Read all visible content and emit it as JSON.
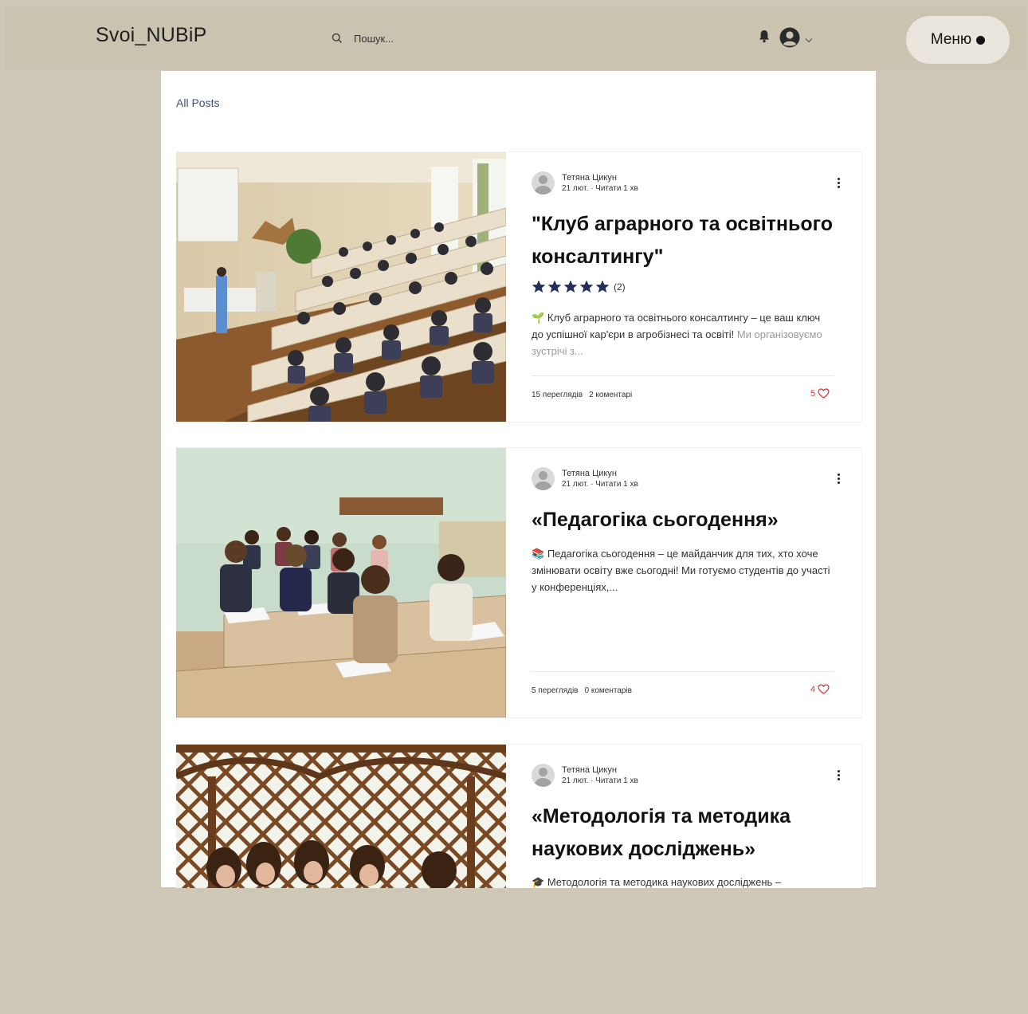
{
  "header": {
    "logo": "Svoi_NUBiP",
    "search_placeholder": "Пошук...",
    "menu_label": "Меню"
  },
  "breadcrumb": "All Posts",
  "colors": {
    "background": "#cfc8b6",
    "header": "#cac3b0",
    "panel": "#ffffff",
    "star": "#23305c",
    "heart": "#d23a3a",
    "link": "#3e5170"
  },
  "posts": [
    {
      "author": "Тетяна Цикун",
      "date": "21 лют.",
      "read_time": "Читати 1 хв",
      "title": "\"Клуб аграрного та освітнього консалтингу\"",
      "rating_count": "(2)",
      "rating": 5,
      "excerpt_icon": "🌱",
      "excerpt": "Клуб аграрного та освітнього консалтингу – це ваш ключ до успішної кар'єри в агробізнесі та освіті!",
      "excerpt_faded": "Ми організовуємо зустрічі з...",
      "views": "15 переглядів",
      "comments": "2 коментарі",
      "likes": "5"
    },
    {
      "author": "Тетяна Цикун",
      "date": "21 лют.",
      "read_time": "Читати 1 хв",
      "title": "«Педагогіка сьогодення»",
      "excerpt_icon": "📚",
      "excerpt": "Педагогіка сьогодення – це майданчик для тих, хто хоче змінювати освіту вже сьогодні! Ми готуємо студентів до участі у конференціях,...",
      "views": "5 переглядів",
      "comments": "0 коментарів",
      "likes": "4"
    },
    {
      "author": "Тетяна Цикун",
      "date": "21 лют.",
      "read_time": "Читати 1 хв",
      "title": "«Методологія та методика наукових досліджень»",
      "excerpt_icon": "🎓",
      "excerpt": "Методологія та методика наукових досліджень –"
    }
  ]
}
